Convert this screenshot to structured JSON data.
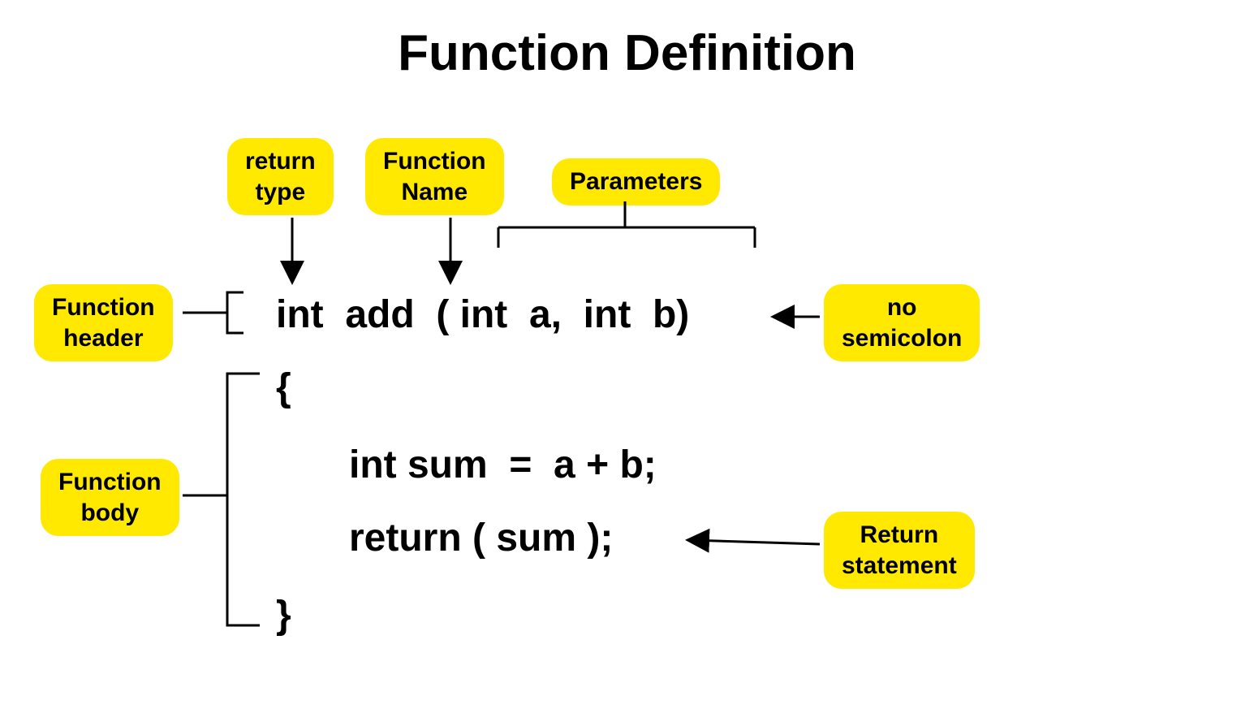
{
  "title": "Function Definition",
  "labels": {
    "return_type": "return\ntype",
    "function_name": "Function\nName",
    "parameters": "Parameters",
    "function_header": "Function\nheader",
    "no_semicolon": "no\nsemicolon",
    "function_body": "Function\nbody",
    "return_statement": "Return\nstatement"
  },
  "code": {
    "header": "int  add  ( int  a,  int  b)",
    "brace_open": "{",
    "line1": "int sum  =  a + b;",
    "line2": "return ( sum );",
    "brace_close": "}"
  }
}
